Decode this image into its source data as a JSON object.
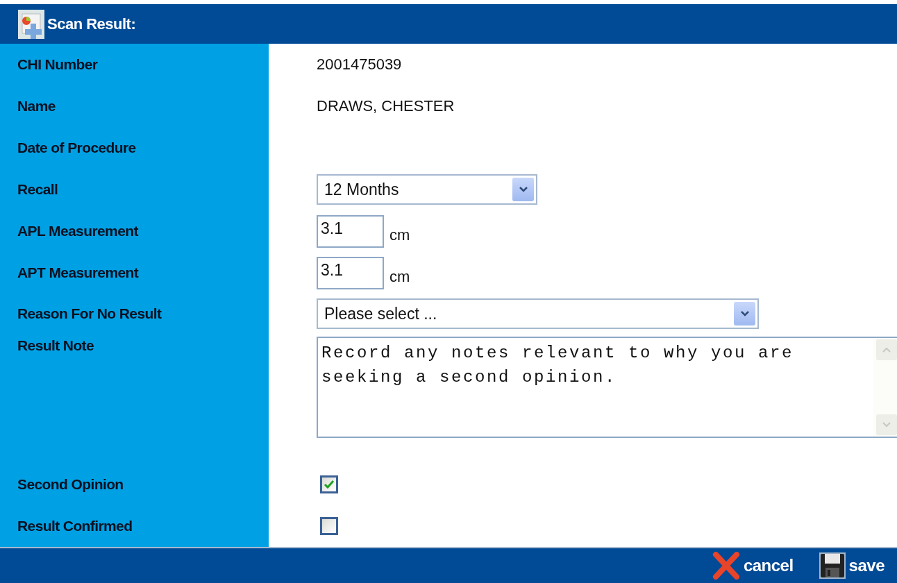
{
  "window": {
    "title": "Scan Result:"
  },
  "fields": [
    {
      "kind": "text",
      "label": "CHI Number",
      "value": "2001475039"
    },
    {
      "kind": "text",
      "label": "Name",
      "value": "DRAWS, CHESTER"
    },
    {
      "kind": "text",
      "label": "Date of Procedure"
    },
    {
      "kind": "select",
      "label": "Recall",
      "value": "12 Months"
    },
    {
      "kind": "measure",
      "label": "APL Measurement",
      "value": "3.1",
      "unit": "cm"
    },
    {
      "kind": "measure",
      "label": "APT Measurement",
      "value": "3.1",
      "unit": "cm"
    },
    {
      "kind": "select",
      "label": "Reason For No Result",
      "value": "Please select ..."
    },
    {
      "kind": "textarea",
      "label": "Result Note",
      "value": "Record any notes relevant to why you are seeking a second opinion."
    },
    {
      "kind": "checkbox",
      "label": "Second Opinion",
      "checked": true
    },
    {
      "kind": "checkbox",
      "label": "Result Confirmed",
      "checked": false
    }
  ],
  "buttons": [
    {
      "kind": "cancel",
      "label": "cancel"
    },
    {
      "kind": "save",
      "label": "save"
    }
  ]
}
